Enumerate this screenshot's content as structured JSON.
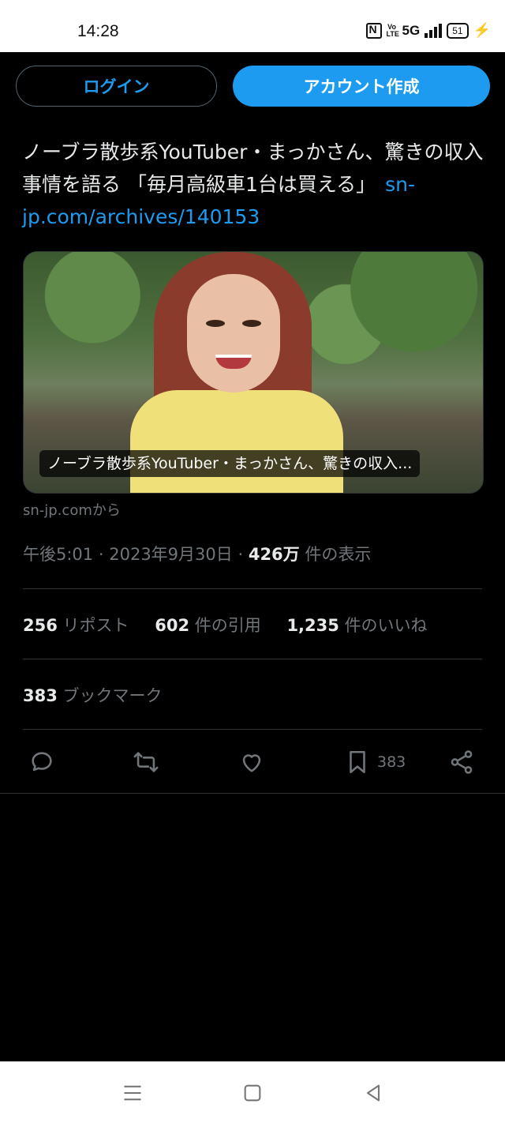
{
  "status_bar": {
    "time": "14:28",
    "network": "5G",
    "volte": "Vo LTE",
    "battery": "51"
  },
  "auth": {
    "login_label": "ログイン",
    "signup_label": "アカウント作成"
  },
  "tweet": {
    "text": "ノーブラ散歩系YouTuber・まっかさん、驚きの収入事情を語る 「毎月高級車1台は買える」",
    "link": "sn-jp.com/archives/140153",
    "card_caption": "ノーブラ散歩系YouTuber・まっかさん、驚きの収入...",
    "source": "sn-jp.comから",
    "time": "午後5:01",
    "date": "2023年9月30日",
    "views_count": "426万",
    "views_label": "件の表示",
    "separator": "·"
  },
  "stats": {
    "reposts_count": "256",
    "reposts_label": "リポスト",
    "quotes_count": "602",
    "quotes_label": "件の引用",
    "likes_count": "1,235",
    "likes_label": "件のいいね",
    "bookmarks_count": "383",
    "bookmarks_label": "ブックマーク"
  },
  "actions": {
    "bookmark_count": "383",
    "icons": [
      "reply-icon",
      "repost-icon",
      "like-icon",
      "bookmark-icon",
      "share-icon"
    ]
  },
  "colors": {
    "accent": "#1d9bf0",
    "background": "#000000",
    "muted": "#71767b",
    "divider": "#2f3336"
  }
}
